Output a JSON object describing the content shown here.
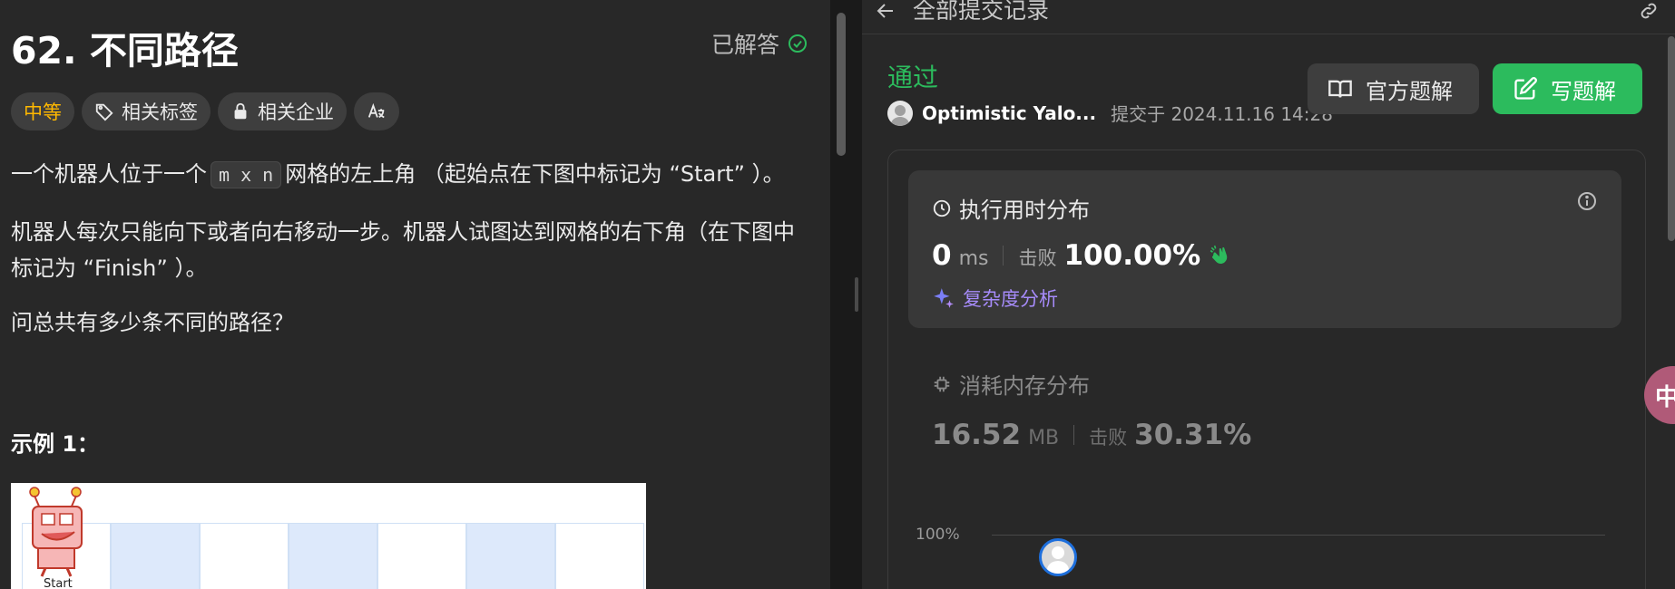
{
  "problem": {
    "title": "62. 不同路径",
    "status": "已解答",
    "tags": {
      "difficulty": "中等",
      "topics": "相关标签",
      "companies": "相关企业"
    },
    "description": {
      "line1_pre": "一个机器人位于一个",
      "line1_code": "m x n",
      "line1_post": "网格的左上角 （起始点在下图中标记为 “Start” ）。",
      "para2": "机器人每次只能向下或者向右移动一步。机器人试图达到网格的右下角（在下图中标记为 “Finish” ）。",
      "para3": "问总共有多少条不同的路径？"
    },
    "example_title": "示例 1：",
    "example_image_label": "Start"
  },
  "submission": {
    "nav_title": "全部提交记录",
    "status": "通过",
    "username": "Optimistic Yalo...",
    "submit_time": "提交于 2024.11.16 14:28",
    "buttons": {
      "official": "官方题解",
      "write": "写题解"
    },
    "runtime": {
      "title": "执行用时分布",
      "value": "0",
      "unit": "ms",
      "beats_label": "击败",
      "beats_percent": "100.00%",
      "complexity_link": "复杂度分析"
    },
    "memory": {
      "title": "消耗内存分布",
      "value": "16.52",
      "unit": "MB",
      "beats_label": "击败",
      "beats_percent": "30.31%"
    },
    "chart": {
      "y_label": "100%"
    }
  },
  "floating_button": "中",
  "colors": {
    "accent_green": "#2cbb5d",
    "difficulty_medium": "#ffb800",
    "complexity_purple": "#a68bfa"
  }
}
